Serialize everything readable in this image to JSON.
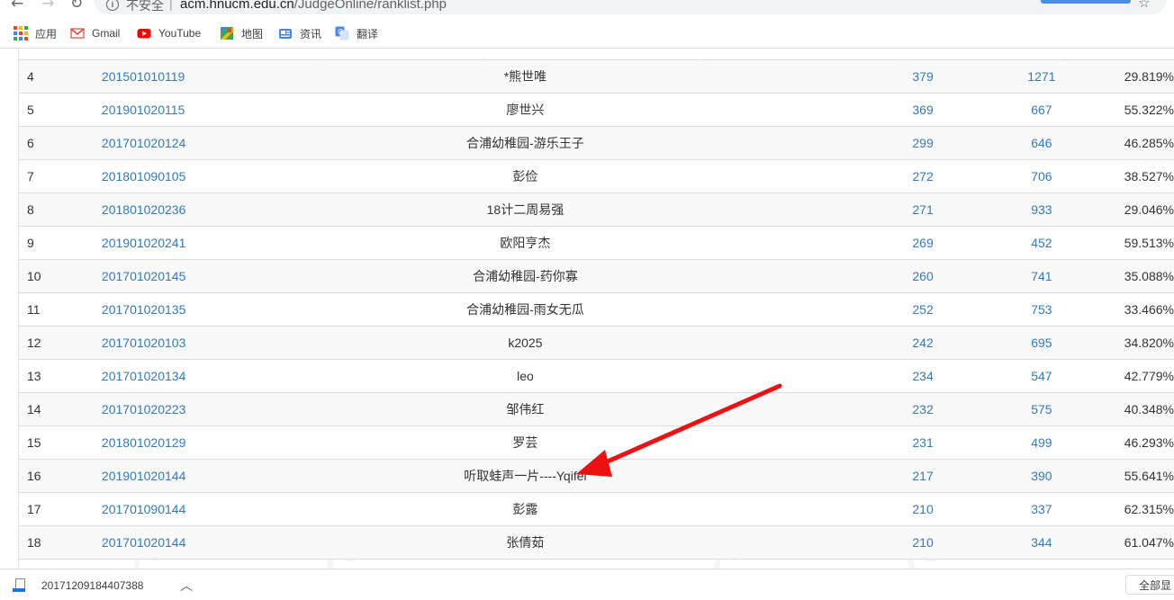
{
  "browser": {
    "security_label": "不安全",
    "separator": "|",
    "url_host": "acm.hnucm.edu.cn",
    "url_path": "/JudgeOnline/ranklist.php"
  },
  "bookmarks": [
    {
      "label": "应用",
      "icon": "apps-grid-icon"
    },
    {
      "label": "Gmail",
      "icon": "gmail-icon"
    },
    {
      "label": "YouTube",
      "icon": "youtube-icon"
    },
    {
      "label": "地图",
      "icon": "maps-icon"
    },
    {
      "label": "资讯",
      "icon": "news-icon"
    },
    {
      "label": "翻译",
      "icon": "translate-icon"
    }
  ],
  "ranklist": {
    "rows": [
      {
        "rank": "4",
        "user": "201501010119",
        "nick": "*熊世唯",
        "solved": "379",
        "submit": "1271",
        "ratio": "29.819%"
      },
      {
        "rank": "5",
        "user": "201901020115",
        "nick": "廖世兴",
        "solved": "369",
        "submit": "667",
        "ratio": "55.322%"
      },
      {
        "rank": "6",
        "user": "201701020124",
        "nick": "合浦幼稚园-游乐王子",
        "solved": "299",
        "submit": "646",
        "ratio": "46.285%"
      },
      {
        "rank": "7",
        "user": "201801090105",
        "nick": "彭俭",
        "solved": "272",
        "submit": "706",
        "ratio": "38.527%"
      },
      {
        "rank": "8",
        "user": "201801020236",
        "nick": "18计二周易强",
        "solved": "271",
        "submit": "933",
        "ratio": "29.046%"
      },
      {
        "rank": "9",
        "user": "201901020241",
        "nick": "欧阳亨杰",
        "solved": "269",
        "submit": "452",
        "ratio": "59.513%"
      },
      {
        "rank": "10",
        "user": "201701020145",
        "nick": "合浦幼稚园-药你寡",
        "solved": "260",
        "submit": "741",
        "ratio": "35.088%"
      },
      {
        "rank": "11",
        "user": "201701020135",
        "nick": "合浦幼稚园-雨女无瓜",
        "solved": "252",
        "submit": "753",
        "ratio": "33.466%"
      },
      {
        "rank": "12",
        "user": "201701020103",
        "nick": "k2025",
        "solved": "242",
        "submit": "695",
        "ratio": "34.820%"
      },
      {
        "rank": "13",
        "user": "201701020134",
        "nick": "leo",
        "solved": "234",
        "submit": "547",
        "ratio": "42.779%"
      },
      {
        "rank": "14",
        "user": "201701020223",
        "nick": "邹伟红",
        "solved": "232",
        "submit": "575",
        "ratio": "40.348%"
      },
      {
        "rank": "15",
        "user": "201801020129",
        "nick": "罗芸",
        "solved": "231",
        "submit": "499",
        "ratio": "46.293%"
      },
      {
        "rank": "16",
        "user": "201901020144",
        "nick": "听取蛙声一片----Yqifei",
        "solved": "217",
        "submit": "390",
        "ratio": "55.641%"
      },
      {
        "rank": "17",
        "user": "201701090144",
        "nick": "彭露",
        "solved": "210",
        "submit": "337",
        "ratio": "62.315%"
      },
      {
        "rank": "18",
        "user": "201701020144",
        "nick": "张倩茹",
        "solved": "210",
        "submit": "344",
        "ratio": "61.047%"
      }
    ]
  },
  "watermark": {
    "words": [
      "ACM",
      "ICPC",
      "HUSTOJ"
    ]
  },
  "annotation": {
    "color": "#ee1111"
  },
  "download_shelf": {
    "file_name": "20171209184407388",
    "show_all_label": "全部显"
  }
}
